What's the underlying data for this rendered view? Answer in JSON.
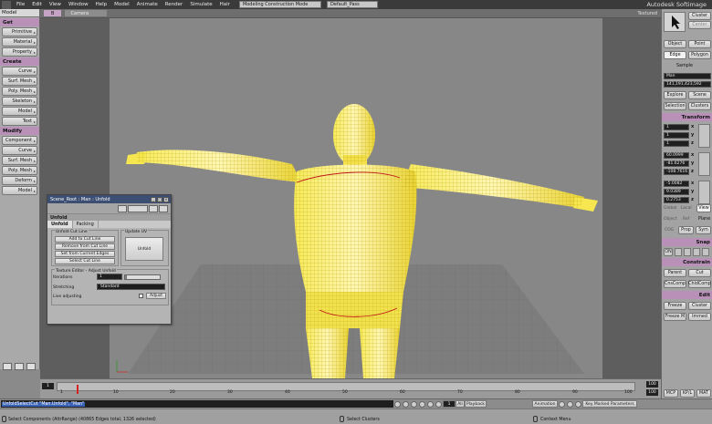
{
  "menubar": {
    "items": [
      "File",
      "Edit",
      "View",
      "Window",
      "Help",
      "Model",
      "Animate",
      "Render",
      "Simulate",
      "Hair"
    ],
    "mode_combo": "Modeling Construction Mode",
    "pass_combo": "Default_Pass",
    "brand": "Autodesk Softimage"
  },
  "leftpanel": {
    "module": "Model",
    "sections": [
      {
        "title": "Get",
        "buttons": [
          "Primitive",
          "Material",
          "Property"
        ]
      },
      {
        "title": "Create",
        "buttons": [
          "Curve",
          "Surf. Mesh",
          "Poly. Mesh",
          "Skeleton",
          "Model",
          "Text"
        ]
      },
      {
        "title": "Modify",
        "buttons": [
          "Component",
          "Curve",
          "Surf. Mesh",
          "Poly. Mesh",
          "Deform",
          "Model"
        ]
      }
    ]
  },
  "viewport": {
    "letter": "B",
    "camera": "Camera",
    "shading": "Textured"
  },
  "dialog": {
    "title": "Scene_Root : Man : Unfold",
    "section": "Unfold",
    "tabs": [
      "Unfold",
      "Packing"
    ],
    "group_cutline": "Unfold Cut Line",
    "buttons": [
      "Add to Cut Line",
      "Remove from Cut Line",
      "Set from Current Edges",
      "Select Cut Line"
    ],
    "group_update": "Update UV",
    "update_button": "Unfold",
    "group_texture": "Texture Editor - Adjust Unfold",
    "iterations_label": "Iterations",
    "iterations_value": "1",
    "iterations_fraction": 0.04,
    "stretching_label": "Stretching",
    "stretching_value": "Standard",
    "live_label": "Live adjusting",
    "adjust_button": "Adjust"
  },
  "rightpanel": {
    "top_buttons": [
      "Cluster",
      "Center",
      "Object",
      "Point",
      "Edge",
      "Polygon",
      "Sample"
    ],
    "selection_field": "Man",
    "selection_info": "141,191,423,592",
    "explore": "Explore",
    "scene": "Scene",
    "selection": "Selection",
    "clusters": "Clusters",
    "transform_title": "Transform",
    "scale": [
      "1",
      "1",
      "1"
    ],
    "rotation": [
      "60.0999",
      "-81.6276",
      "-108.7616"
    ],
    "translation": [
      "-5.0082",
      "9.0389",
      "0.2753"
    ],
    "axes": [
      "x",
      "y",
      "z"
    ],
    "ref_row1": [
      "Global",
      "Local",
      "View"
    ],
    "ref_row2": [
      "Object",
      "Ref",
      "Plane"
    ],
    "ref_row3": [
      "COG",
      "Prop",
      "Sym"
    ],
    "snap_title": "Snap",
    "snap_on": "ON",
    "constrain_title": "Constrain",
    "constrain_buttons": [
      "Parent",
      "Cut",
      "CnsComp",
      "ChldComp"
    ],
    "edit_title": "Edit",
    "edit_buttons": [
      "Freeze",
      "Cluster",
      "Freeze M",
      "Immed"
    ]
  },
  "timeline": {
    "start": "1",
    "end": "100",
    "ticks": [
      "1",
      "10",
      "20",
      "30",
      "40",
      "50",
      "60",
      "70",
      "80",
      "90",
      "100"
    ],
    "current": "100"
  },
  "cmdbar": {
    "command": "UnfoldSelectCut \"Man.Unfold\", \"Man\"",
    "frame": "1",
    "all": "All",
    "playback": "Playback",
    "animation": "Animation",
    "keymarked": "Key Marked Parameters",
    "tabs": [
      "MCP",
      "KP/L",
      "MAT"
    ]
  },
  "statusbar": {
    "left": "Select Components (AltrRange) (40865 Edges total, 1326 selected)",
    "middle": "Select Clusters",
    "right": "Context Menu"
  },
  "colors": {
    "section_accent": "#b890b8",
    "mesh_yellow": "#f2e020",
    "viewport_grey": "#878787",
    "dialog_title": "#3c4f73"
  }
}
